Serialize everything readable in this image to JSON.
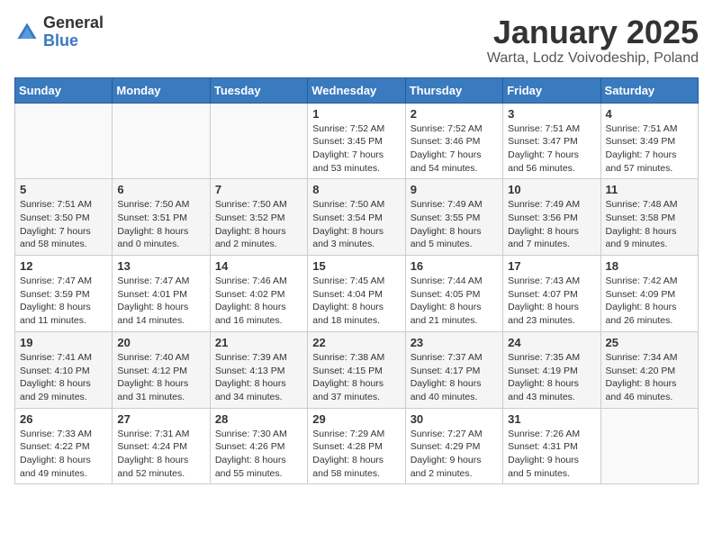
{
  "logo": {
    "general": "General",
    "blue": "Blue"
  },
  "title": "January 2025",
  "subtitle": "Warta, Lodz Voivodeship, Poland",
  "days_of_week": [
    "Sunday",
    "Monday",
    "Tuesday",
    "Wednesday",
    "Thursday",
    "Friday",
    "Saturday"
  ],
  "weeks": [
    [
      {
        "day": "",
        "info": ""
      },
      {
        "day": "",
        "info": ""
      },
      {
        "day": "",
        "info": ""
      },
      {
        "day": "1",
        "info": "Sunrise: 7:52 AM\nSunset: 3:45 PM\nDaylight: 7 hours\nand 53 minutes."
      },
      {
        "day": "2",
        "info": "Sunrise: 7:52 AM\nSunset: 3:46 PM\nDaylight: 7 hours\nand 54 minutes."
      },
      {
        "day": "3",
        "info": "Sunrise: 7:51 AM\nSunset: 3:47 PM\nDaylight: 7 hours\nand 56 minutes."
      },
      {
        "day": "4",
        "info": "Sunrise: 7:51 AM\nSunset: 3:49 PM\nDaylight: 7 hours\nand 57 minutes."
      }
    ],
    [
      {
        "day": "5",
        "info": "Sunrise: 7:51 AM\nSunset: 3:50 PM\nDaylight: 7 hours\nand 58 minutes."
      },
      {
        "day": "6",
        "info": "Sunrise: 7:50 AM\nSunset: 3:51 PM\nDaylight: 8 hours\nand 0 minutes."
      },
      {
        "day": "7",
        "info": "Sunrise: 7:50 AM\nSunset: 3:52 PM\nDaylight: 8 hours\nand 2 minutes."
      },
      {
        "day": "8",
        "info": "Sunrise: 7:50 AM\nSunset: 3:54 PM\nDaylight: 8 hours\nand 3 minutes."
      },
      {
        "day": "9",
        "info": "Sunrise: 7:49 AM\nSunset: 3:55 PM\nDaylight: 8 hours\nand 5 minutes."
      },
      {
        "day": "10",
        "info": "Sunrise: 7:49 AM\nSunset: 3:56 PM\nDaylight: 8 hours\nand 7 minutes."
      },
      {
        "day": "11",
        "info": "Sunrise: 7:48 AM\nSunset: 3:58 PM\nDaylight: 8 hours\nand 9 minutes."
      }
    ],
    [
      {
        "day": "12",
        "info": "Sunrise: 7:47 AM\nSunset: 3:59 PM\nDaylight: 8 hours\nand 11 minutes."
      },
      {
        "day": "13",
        "info": "Sunrise: 7:47 AM\nSunset: 4:01 PM\nDaylight: 8 hours\nand 14 minutes."
      },
      {
        "day": "14",
        "info": "Sunrise: 7:46 AM\nSunset: 4:02 PM\nDaylight: 8 hours\nand 16 minutes."
      },
      {
        "day": "15",
        "info": "Sunrise: 7:45 AM\nSunset: 4:04 PM\nDaylight: 8 hours\nand 18 minutes."
      },
      {
        "day": "16",
        "info": "Sunrise: 7:44 AM\nSunset: 4:05 PM\nDaylight: 8 hours\nand 21 minutes."
      },
      {
        "day": "17",
        "info": "Sunrise: 7:43 AM\nSunset: 4:07 PM\nDaylight: 8 hours\nand 23 minutes."
      },
      {
        "day": "18",
        "info": "Sunrise: 7:42 AM\nSunset: 4:09 PM\nDaylight: 8 hours\nand 26 minutes."
      }
    ],
    [
      {
        "day": "19",
        "info": "Sunrise: 7:41 AM\nSunset: 4:10 PM\nDaylight: 8 hours\nand 29 minutes."
      },
      {
        "day": "20",
        "info": "Sunrise: 7:40 AM\nSunset: 4:12 PM\nDaylight: 8 hours\nand 31 minutes."
      },
      {
        "day": "21",
        "info": "Sunrise: 7:39 AM\nSunset: 4:13 PM\nDaylight: 8 hours\nand 34 minutes."
      },
      {
        "day": "22",
        "info": "Sunrise: 7:38 AM\nSunset: 4:15 PM\nDaylight: 8 hours\nand 37 minutes."
      },
      {
        "day": "23",
        "info": "Sunrise: 7:37 AM\nSunset: 4:17 PM\nDaylight: 8 hours\nand 40 minutes."
      },
      {
        "day": "24",
        "info": "Sunrise: 7:35 AM\nSunset: 4:19 PM\nDaylight: 8 hours\nand 43 minutes."
      },
      {
        "day": "25",
        "info": "Sunrise: 7:34 AM\nSunset: 4:20 PM\nDaylight: 8 hours\nand 46 minutes."
      }
    ],
    [
      {
        "day": "26",
        "info": "Sunrise: 7:33 AM\nSunset: 4:22 PM\nDaylight: 8 hours\nand 49 minutes."
      },
      {
        "day": "27",
        "info": "Sunrise: 7:31 AM\nSunset: 4:24 PM\nDaylight: 8 hours\nand 52 minutes."
      },
      {
        "day": "28",
        "info": "Sunrise: 7:30 AM\nSunset: 4:26 PM\nDaylight: 8 hours\nand 55 minutes."
      },
      {
        "day": "29",
        "info": "Sunrise: 7:29 AM\nSunset: 4:28 PM\nDaylight: 8 hours\nand 58 minutes."
      },
      {
        "day": "30",
        "info": "Sunrise: 7:27 AM\nSunset: 4:29 PM\nDaylight: 9 hours\nand 2 minutes."
      },
      {
        "day": "31",
        "info": "Sunrise: 7:26 AM\nSunset: 4:31 PM\nDaylight: 9 hours\nand 5 minutes."
      },
      {
        "day": "",
        "info": ""
      }
    ]
  ]
}
